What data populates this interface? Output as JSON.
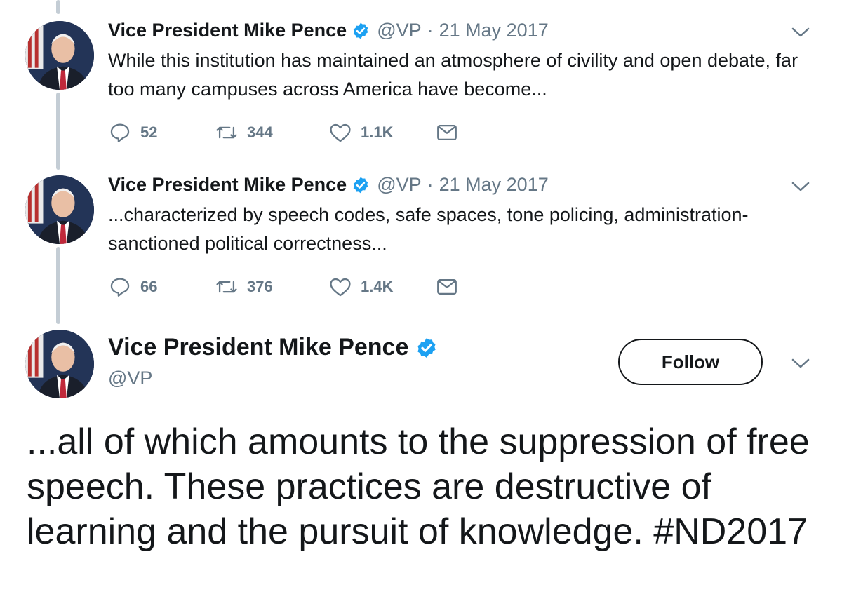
{
  "tweets": [
    {
      "name": "Vice President Mike Pence",
      "handle": "@VP",
      "separator": "·",
      "date": "21 May 2017",
      "text": "While this institution has maintained an atmosphere of civility and open debate, far too many campuses across America have become...",
      "replies": "52",
      "retweets": "344",
      "likes": "1.1K"
    },
    {
      "name": "Vice President Mike Pence",
      "handle": "@VP",
      "separator": "·",
      "date": "21 May 2017",
      "text": "...characterized by speech codes, safe spaces, tone policing, administration-sanctioned political correctness...",
      "replies": "66",
      "retweets": "376",
      "likes": "1.4K"
    }
  ],
  "main_tweet": {
    "name": "Vice President Mike Pence",
    "handle": "@VP",
    "follow_label": "Follow",
    "text": "...all of which amounts to the suppression of free speech. These practices are destructive of learning and the pursuit of knowledge. #ND2017"
  },
  "colors": {
    "verified": "#1da1f2",
    "secondary_text": "#657786",
    "primary_text": "#14171a",
    "thread_line": "#c4cdd5"
  },
  "icons": [
    "reply-icon",
    "retweet-icon",
    "like-icon",
    "direct-message-icon",
    "verified-badge-icon",
    "chevron-down-icon"
  ]
}
